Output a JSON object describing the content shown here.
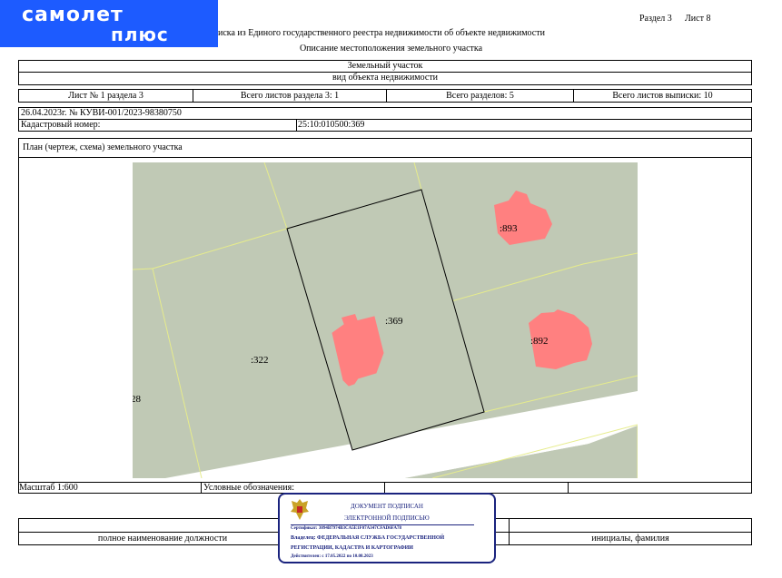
{
  "brand": {
    "line1": "самолет",
    "line2": "плюс"
  },
  "header": {
    "section_label": "Раздел 3",
    "sheet_label": "Лист 8",
    "title_fragment": "иска из Единого государственного реестра недвижимости об объекте недвижимости",
    "subtitle": "Описание местоположения земельного участка"
  },
  "form": {
    "object": "Земельный участок",
    "object_kind": "вид объекта недвижимости",
    "info_row": [
      "Лист № 1 раздела 3",
      "Всего листов раздела 3: 1",
      "Всего разделов: 5",
      "Всего листов выписки: 10"
    ],
    "date_number": "26.04.2023г. № КУВИ-001/2023-98380750",
    "cadastral_label": "Кадастровый номер:",
    "cadastral_value": "25:10:010500:369",
    "plan_title": "План (чертеж, схема) земельного участка",
    "scale": "Масштаб 1:600",
    "legend_label": "Условные обозначения:",
    "position_label": "полное наименование должности",
    "name_label": "инициалы, фамилия"
  },
  "map": {
    "parcel_labels": [
      ":369",
      ":322",
      ":893",
      ":892",
      "28"
    ],
    "colors": {
      "land": "#c0c9b5",
      "road": "#ffffff",
      "building": "#ff8080",
      "boundary": "#e6ec8c",
      "main_boundary": "#000000"
    }
  },
  "stamp": {
    "title": "ДОКУМЕНТ ПОДПИСАН",
    "subtitle": "ЭЛЕКТРОННОЙ ПОДПИСЬЮ",
    "certificate": "Сертификат: 3094B7974B3CA5E1F07A347CFAD6FA78",
    "owner": "Владелец: ФЕДЕРАЛЬНАЯ СЛУЖБА ГОСУДАРСТВЕННОЙ",
    "owner2": "РЕГИСТРАЦИИ, КАДАСТРА И КАРТОГРАФИИ",
    "validity": "Действителен: с 17.05.2022 по 10.08.2023",
    "emblem_icon": "eagle-emblem-icon"
  }
}
